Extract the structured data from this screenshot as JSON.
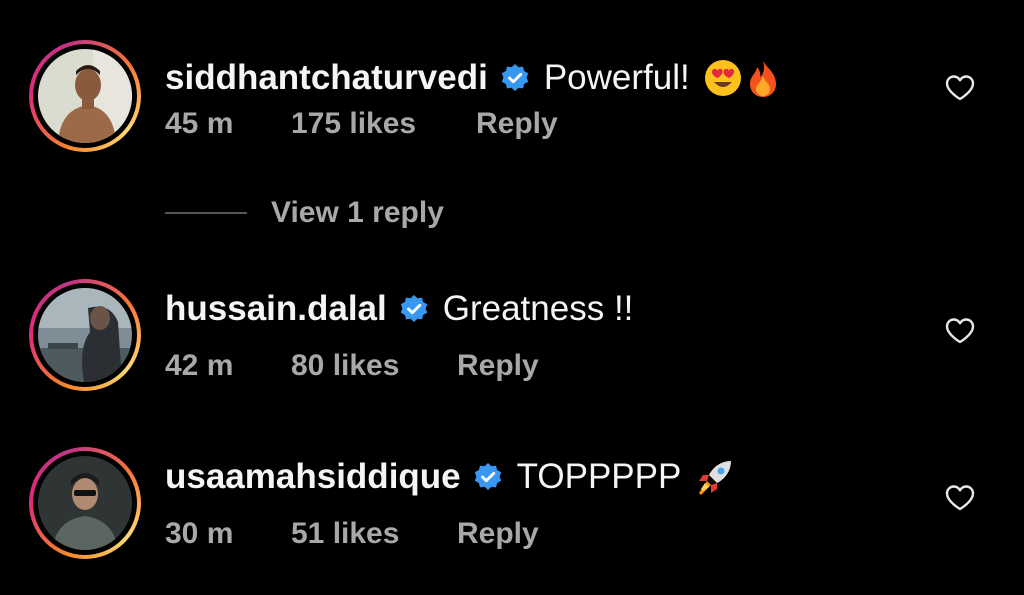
{
  "comments": [
    {
      "username": "siddhantchaturvedi",
      "verified": true,
      "text": "Powerful!",
      "emojis": [
        "heart-eyes-emoji",
        "fire-emoji"
      ],
      "time": "45 m",
      "likes": "175 likes",
      "reply": "Reply"
    },
    {
      "username": "hussain.dalal",
      "verified": true,
      "text": "Greatness !!",
      "emojis": [],
      "time": "42 m",
      "likes": "80 likes",
      "reply": "Reply"
    },
    {
      "username": "usaamahsiddique",
      "verified": true,
      "text": "TOPPPPP",
      "emojis": [
        "rocket-emoji"
      ],
      "time": "30 m",
      "likes": "51 likes",
      "reply": "Reply"
    }
  ],
  "view_replies": "View 1 reply",
  "colors": {
    "background": "#000000",
    "primary_text": "#f5f5f5",
    "secondary_text": "#a8a8a8",
    "verified": "#3897f0"
  },
  "icons": {
    "like": "heart-outline-icon",
    "verified": "verified-badge-icon"
  }
}
